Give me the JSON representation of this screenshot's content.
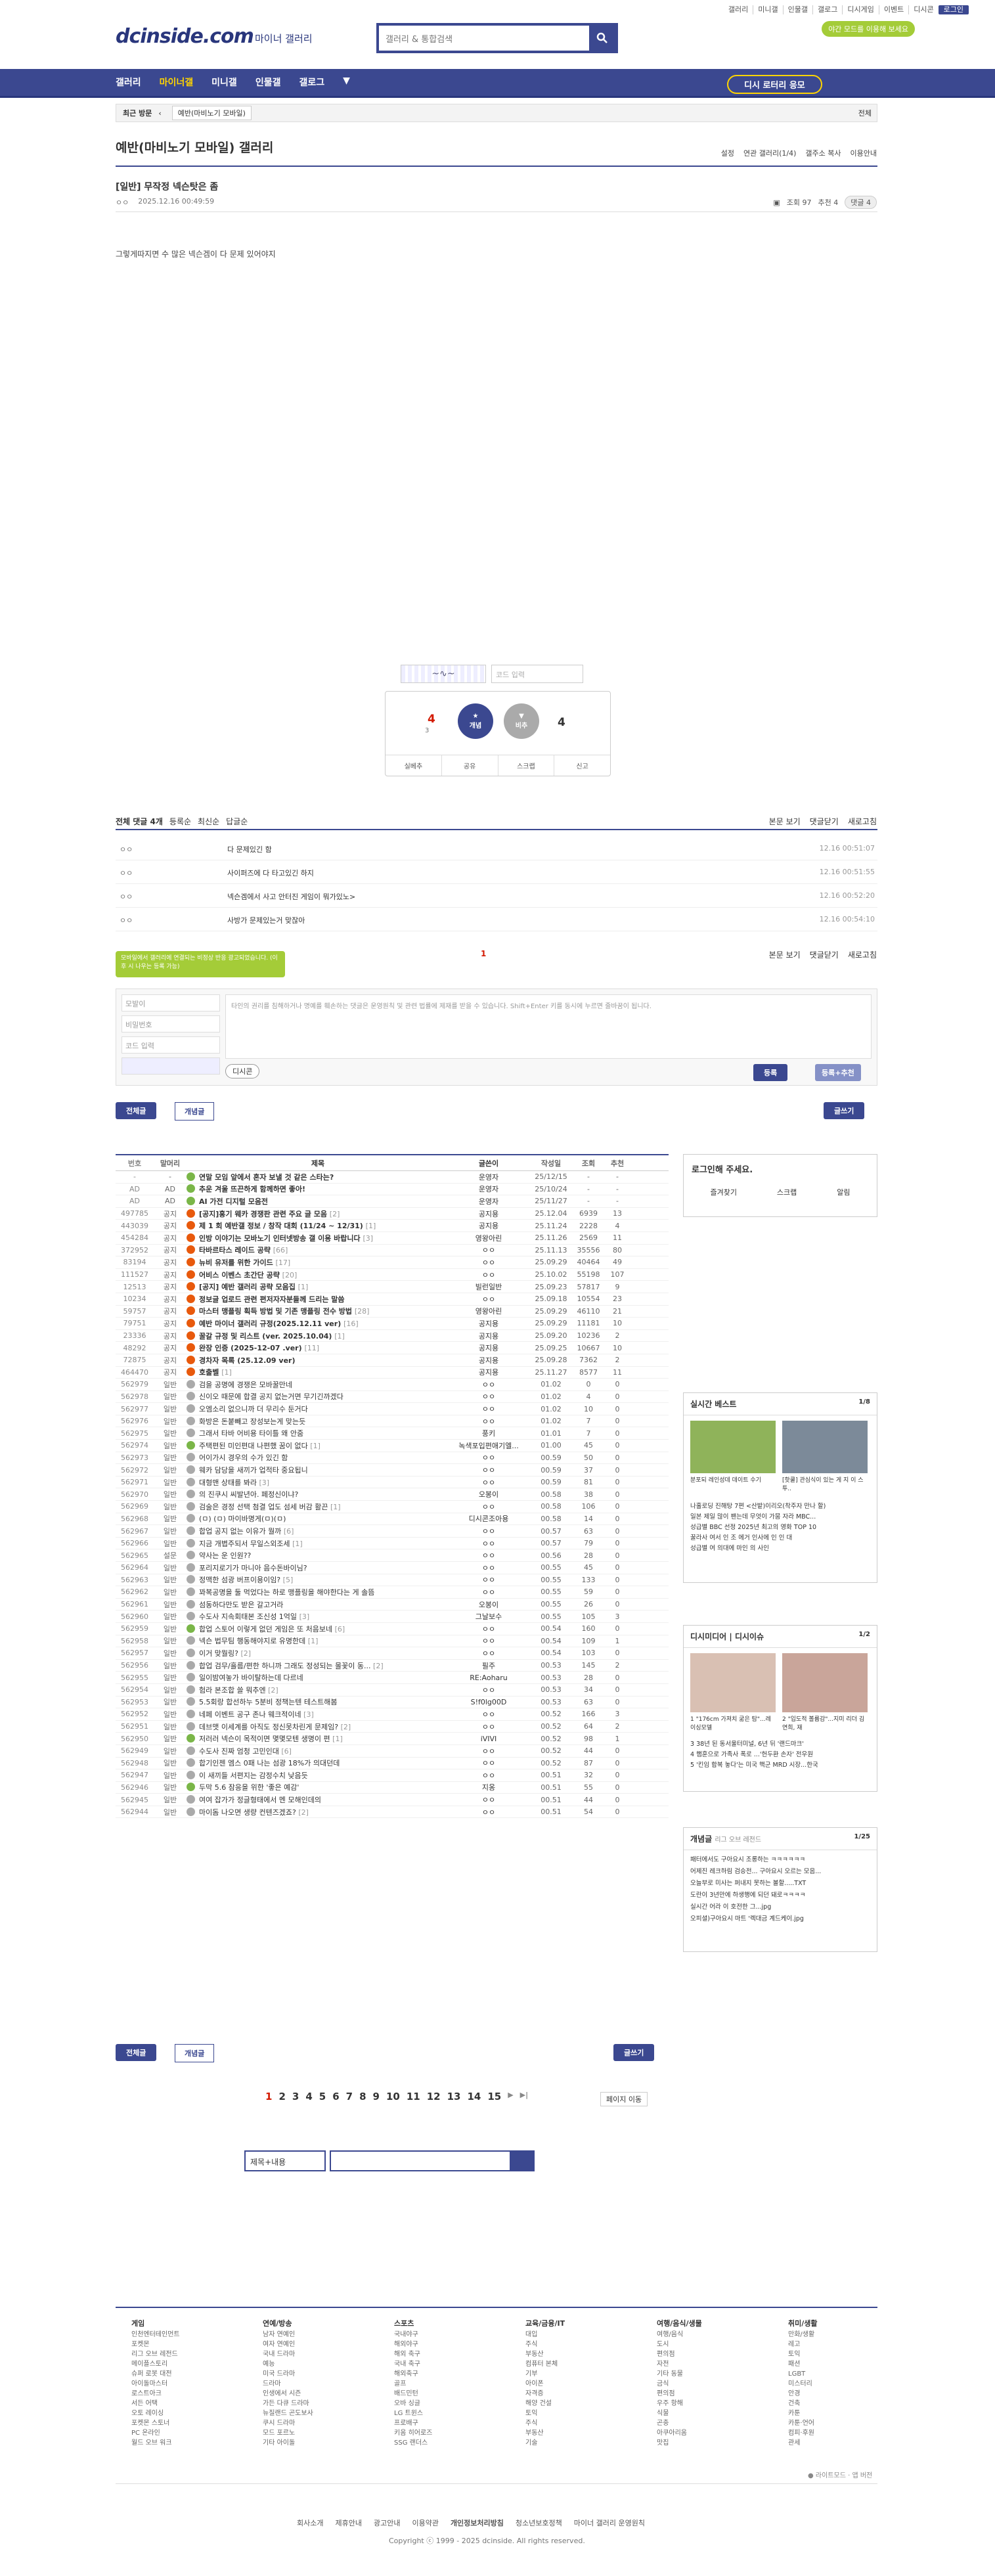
{
  "header": {
    "top_links": [
      "갤러리",
      "미니갤",
      "인물갤",
      "갤로그",
      "디시게임",
      "이벤트",
      "디시콘",
      "로그인"
    ],
    "darkmode": "야간 모드를 이용해 보세요",
    "logo": "dcinside.com",
    "logo_sub": "마이너 갤러리",
    "search_placeholder": "갤러리 & 통합검색"
  },
  "nav": {
    "items": [
      "갤러리",
      "마이너갤",
      "미니갤",
      "인물갤",
      "갤로그"
    ],
    "right_button": "디시 로터리 응모"
  },
  "recent": {
    "label": "최근 방문",
    "chip": "예반(마비노기 모바일)",
    "all": "전체"
  },
  "gallery": {
    "title": "예반(마비노기 모바일) 갤러리",
    "tools": [
      "설정",
      "연관 갤러리(1/4)",
      "갤주소 복사",
      "이용안내"
    ]
  },
  "post": {
    "title": "[일반] 무작정 넥슨탓은 좀",
    "author": "ㅇㅇ",
    "date": "2025.12.16 00:49:59",
    "views": "조회 97",
    "recommend": "추천 4",
    "comments": "댓글 4",
    "body": "그렇게따지면 수 많은 넥슨겜이 다 문제 있어야지"
  },
  "captcha": {
    "placeholder": "코드 입력"
  },
  "reco": {
    "up": "4",
    "up_fix": "3",
    "up_label": "개념",
    "down_label": "비추",
    "down": "4",
    "actions": [
      "실베추",
      "공유",
      "스크랩",
      "신고"
    ]
  },
  "comments": {
    "total": "전체 댓글 4개",
    "sorts": [
      "등록순",
      "최신순",
      "답글순"
    ],
    "right": [
      "본문 보기",
      "댓글닫기",
      "새로고침"
    ],
    "items": [
      {
        "nick": "ㅇㅇ",
        "text": "다 문제있긴 함",
        "date": "12.16 00:51:07"
      },
      {
        "nick": "ㅇㅇ",
        "text": "사이퍼즈에 다 타고있긴 하지",
        "date": "12.16 00:51:55"
      },
      {
        "nick": "ㅇㅇ",
        "text": "넥슨겜에서 사고 안터진 게임이 뭐가있노>",
        "date": "12.16 00:52:20"
      },
      {
        "nick": "ㅇㅇ",
        "text": "사방가 문제있는거 맞잖아",
        "date": "12.16 00:54:10"
      }
    ],
    "count_mid": "1"
  },
  "write": {
    "tip": "모바일에서 갤러리에 연결되는 비정상 반응 광고되었습니다. (이후 시 나우는 등록 가능)",
    "nick": "모발이",
    "pw": "비밀번호",
    "code": "코드 입력",
    "textarea": "타인의 권리를 침해하거나 명예를 훼손하는 댓글은 운영원칙 및 관련 법률에 제재를 받을 수 있습니다. Shift+Enter 키를 동시에 누르면 줄바꿈이 됩니다.",
    "dccon": "디시콘",
    "submit": "등록",
    "submit_rec": "등록+추천"
  },
  "list_buttons": {
    "all": "전체글",
    "concept": "개념글",
    "write": "글쓰기"
  },
  "list": {
    "headers": [
      "번호",
      "말머리",
      "제목",
      "글쓴이",
      "작성일",
      "조회",
      "추천"
    ],
    "rows": [
      {
        "no": "-",
        "tag": "-",
        "title": "연말 모임 앞에서 혼자 보낼 것 같은 스타는?",
        "writer": "운영자",
        "date": "25/12/15",
        "view": "-",
        "rec": "-",
        "notice": true,
        "ic": "gr"
      },
      {
        "no": "AD",
        "tag": "AD",
        "title": "추운 겨울 뜨끈하게 함께하면 좋아!",
        "writer": "운영자",
        "date": "25/10/24",
        "view": "-",
        "rec": "-",
        "notice": true,
        "ic": "gr"
      },
      {
        "no": "AD",
        "tag": "AD",
        "title": "AI 가전 디지털 모음전",
        "writer": "운영자",
        "date": "25/11/27",
        "view": "-",
        "rec": "-",
        "notice": true,
        "ic": "gr"
      },
      {
        "no": "497785",
        "tag": "공지",
        "title": "[공지]홍기 웨카 경쟁판 관련 주요 글 모음",
        "cc": "[2]",
        "writer": "공지용",
        "date": "25.12.04",
        "view": "6939",
        "rec": "13",
        "notice": true,
        "ic": "o"
      },
      {
        "no": "443039",
        "tag": "공지",
        "title": "제 1 회 예반갤 정보 / 창작 대회 (11/24 ~ 12/31)",
        "cc": "[1]",
        "writer": "공지용",
        "date": "25.11.24",
        "view": "2228",
        "rec": "4",
        "notice": true,
        "ic": "o"
      },
      {
        "no": "454284",
        "tag": "공지",
        "title": "인방 이야기는 모바노기 인터넷방송 갤 이용 바랍니다",
        "cc": "[3]",
        "writer": "영왕아린",
        "date": "25.11.26",
        "view": "2569",
        "rec": "11",
        "notice": true,
        "ic": "o"
      },
      {
        "no": "372952",
        "tag": "공지",
        "title": "타바르타스 레이드 공략",
        "cc": "[66]",
        "writer": "ㅇㅇ",
        "date": "25.11.13",
        "view": "35556",
        "rec": "80",
        "notice": true,
        "ic": "o"
      },
      {
        "no": "83194",
        "tag": "공지",
        "title": "뉴비 유저를 위한 가이드",
        "cc": "[17]",
        "writer": "ㅇㅇ",
        "date": "25.09.29",
        "view": "40464",
        "rec": "49",
        "notice": true,
        "ic": "o"
      },
      {
        "no": "111527",
        "tag": "공지",
        "title": "어비스 이벤스 초간단 공략",
        "cc": "[20]",
        "writer": "ㅇㅇ",
        "date": "25.10.02",
        "view": "55198",
        "rec": "107",
        "notice": true,
        "ic": "o"
      },
      {
        "no": "12513",
        "tag": "공지",
        "title": "[공지] 예반 갤러리 공략 모음집",
        "cc": "[1]",
        "writer": "빌런일반",
        "date": "25.09.23",
        "view": "57817",
        "rec": "9",
        "notice": true,
        "ic": "o"
      },
      {
        "no": "10234",
        "tag": "공지",
        "title": "정보글 업로드 관련 편저자자분들께 드리는 말씀",
        "writer": "ㅇㅇ",
        "date": "25.09.18",
        "view": "10554",
        "rec": "23",
        "notice": true,
        "ic": "o"
      },
      {
        "no": "59757",
        "tag": "공지",
        "title": "마스터 맹플링 획득 방법 및 기존 맹플링 전수 방법",
        "cc": "[28]",
        "writer": "영왕아린",
        "date": "25.09.29",
        "view": "46110",
        "rec": "21",
        "notice": true,
        "ic": "o"
      },
      {
        "no": "79751",
        "tag": "공지",
        "title": "예반 마이너 갤러리 규정(2025.12.11 ver)",
        "cc": "[16]",
        "writer": "공지용",
        "date": "25.09.29",
        "view": "11181",
        "rec": "10",
        "notice": true,
        "ic": "o"
      },
      {
        "no": "23336",
        "tag": "공지",
        "title": "꿀갈 규정 및 리스트 (ver. 2025.10.04)",
        "cc": "[1]",
        "writer": "공지용",
        "date": "25.09.20",
        "view": "10236",
        "rec": "2",
        "notice": true,
        "ic": "o"
      },
      {
        "no": "48292",
        "tag": "공지",
        "title": "완장 인증 (2025-12-07 .ver)",
        "cc": "[11]",
        "writer": "공지용",
        "date": "25.09.25",
        "view": "10667",
        "rec": "10",
        "notice": true,
        "ic": "o"
      },
      {
        "no": "72875",
        "tag": "공지",
        "title": "경차자 목록 (25.12.09 ver)",
        "writer": "공지용",
        "date": "25.09.28",
        "view": "7362",
        "rec": "2",
        "notice": true,
        "ic": "o"
      },
      {
        "no": "464470",
        "tag": "공지",
        "title": "호출벨",
        "cc": "[1]",
        "writer": "공지용",
        "date": "25.11.27",
        "view": "8577",
        "rec": "11",
        "notice": true,
        "ic": "o"
      },
      {
        "no": "562979",
        "tag": "일반",
        "title": "검을 공명에 경쟁은 모바꿀만네",
        "writer": "ㅇㅇ",
        "date": "01.02",
        "view": "0",
        "rec": "0",
        "ic": "g"
      },
      {
        "no": "562978",
        "tag": "일반",
        "title": "신이오 때문에 합결 공지 없는거면 무기긴까겠다",
        "writer": "ㅇㅇ",
        "date": "01.02",
        "view": "4",
        "rec": "0",
        "ic": "g"
      },
      {
        "no": "562977",
        "tag": "일반",
        "title": "오엠소리 없으니까 더 무리수 둔거다",
        "writer": "ㅇㅇ",
        "date": "01.02",
        "view": "10",
        "rec": "0",
        "ic": "g"
      },
      {
        "no": "562976",
        "tag": "일반",
        "title": "화방은 돈붙빼고 장성보는게 맞는듯",
        "writer": "ㅇㅇ",
        "date": "01.02",
        "view": "7",
        "rec": "0",
        "ic": "g"
      },
      {
        "no": "562975",
        "tag": "일반",
        "title": "그래서 타바 어비용 타이틀 왜 안줌",
        "writer": "풍키",
        "date": "01.01",
        "view": "7",
        "rec": "0",
        "ic": "g"
      },
      {
        "no": "562974",
        "tag": "일반",
        "title": "주택편된 미인편대 나편했 꿈이 없다",
        "cc": "[1]",
        "writer": "녹색포입편애기엘...",
        "date": "01.00",
        "view": "45",
        "rec": "0",
        "ic": "gr"
      },
      {
        "no": "562973",
        "tag": "일반",
        "title": "어이가시 경우의 수가 있긴 함",
        "writer": "ㅇㅇ",
        "date": "00.59",
        "view": "50",
        "rec": "0",
        "ic": "g"
      },
      {
        "no": "562972",
        "tag": "일반",
        "title": "웨카 담당을 새끼가 업적타 중요됩니",
        "writer": "ㅇㅇ",
        "date": "00.59",
        "view": "37",
        "rec": "0",
        "ic": "g"
      },
      {
        "no": "562971",
        "tag": "일반",
        "title": "대형맨 상태를 봐라",
        "cc": "[3]",
        "writer": "ㅇㅇ",
        "date": "00.59",
        "view": "81",
        "rec": "0",
        "ic": "g"
      },
      {
        "no": "562970",
        "tag": "일반",
        "title": "의 진쿠시 씨발년아. 페정신이냐?",
        "writer": "오봉이",
        "date": "00.58",
        "view": "38",
        "rec": "0",
        "ic": "g"
      },
      {
        "no": "562969",
        "tag": "일반",
        "title": "검술은 경정 선택 첨결 업도 섬세 버감 활끈",
        "cc": "[1]",
        "writer": "ㅇㅇ",
        "date": "00.58",
        "view": "106",
        "rec": "0",
        "ic": "g"
      },
      {
        "no": "562968",
        "tag": "일반",
        "title": "(ㅁ) (ㅁ) 마이바명게(ㅁ)(ㅁ)",
        "writer": "디시콘조아용",
        "date": "00.58",
        "view": "14",
        "rec": "0",
        "ic": "g"
      },
      {
        "no": "562967",
        "tag": "일반",
        "title": "합업 공지 없는 이유가 뭘까",
        "cc": "[6]",
        "writer": "ㅇㅇ",
        "date": "00.57",
        "view": "63",
        "rec": "0",
        "ic": "g"
      },
      {
        "no": "562966",
        "tag": "일반",
        "title": "지금 개볍주되서 무일스외조세",
        "cc": "[1]",
        "writer": "ㅇㅇ",
        "date": "00.57",
        "view": "79",
        "rec": "0",
        "ic": "g"
      },
      {
        "no": "562965",
        "tag": "설문",
        "title": "약사는 운 인원??",
        "writer": "ㅇㅇ",
        "date": "00.56",
        "view": "28",
        "rec": "0",
        "ic": "g"
      },
      {
        "no": "562964",
        "tag": "일반",
        "title": "포리지로기가 마니아 음수돈바이님?",
        "writer": "ㅇㅇ",
        "date": "00.55",
        "view": "45",
        "rec": "0",
        "ic": "g"
      },
      {
        "no": "562963",
        "tag": "일반",
        "title": "정맥한 섬광 버프이용이임?",
        "cc": "[5]",
        "writer": "ㅇㅇ",
        "date": "00.55",
        "view": "133",
        "rec": "0",
        "ic": "g"
      },
      {
        "no": "562962",
        "tag": "일반",
        "title": "꽈복공명을 둘 먹었다는 하로 맹플링을 해야한다는 게 솔뜸",
        "writer": "ㅇㅇ",
        "date": "00.55",
        "view": "59",
        "rec": "0",
        "ic": "g"
      },
      {
        "no": "562961",
        "tag": "일반",
        "title": "섬동하다만도 받은 갈고거라",
        "writer": "오봉이",
        "date": "00.55",
        "view": "26",
        "rec": "0",
        "ic": "g"
      },
      {
        "no": "562960",
        "tag": "일반",
        "title": "수도사 지속회태본 조신성 1억일",
        "cc": "[3]",
        "writer": "그날보수",
        "date": "00.55",
        "view": "105",
        "rec": "3",
        "ic": "g"
      },
      {
        "no": "562959",
        "tag": "일반",
        "title": "합업 스토어 이렇게 없던 게임은 또 처음보네",
        "cc": "[6]",
        "writer": "ㅇㅇ",
        "date": "00.54",
        "view": "160",
        "rec": "0",
        "ic": "gr"
      },
      {
        "no": "562958",
        "tag": "일반",
        "title": "넥슨 법무팀 행동해야지로 유명한데",
        "cc": "[1]",
        "writer": "ㅇㅇ",
        "date": "00.54",
        "view": "109",
        "rec": "1",
        "ic": "g"
      },
      {
        "no": "562957",
        "tag": "일반",
        "title": "이거 맞뭘링?",
        "cc": "[2]",
        "writer": "ㅇㅇ",
        "date": "00.54",
        "view": "103",
        "rec": "0",
        "ic": "g"
      },
      {
        "no": "562956",
        "tag": "일반",
        "title": "합업 검무/흘름/편한 하니까 그래도 정성되는 몰꽃이 동...",
        "cc": "[2]",
        "writer": "필주",
        "date": "00.53",
        "view": "145",
        "rec": "2",
        "ic": "g"
      },
      {
        "no": "562955",
        "tag": "일반",
        "title": "일이밤여놓가 바이탈하는데 다르네",
        "writer": "RE:Aoharu",
        "date": "00.53",
        "view": "28",
        "rec": "0",
        "ic": "g"
      },
      {
        "no": "562954",
        "tag": "일반",
        "title": "험라 본조합 쓸 뭐추엔",
        "cc": "[2]",
        "writer": "ㅇㅇ",
        "date": "00.53",
        "view": "34",
        "rec": "0",
        "ic": "g"
      },
      {
        "no": "562953",
        "tag": "일반",
        "title": "5.5회랑 합선하누 5분비 정책는텐 테스트해봄",
        "writer": "S!f0lg00D",
        "date": "00.53",
        "view": "63",
        "rec": "0",
        "ic": "g"
      },
      {
        "no": "562952",
        "tag": "일반",
        "title": "네페 이벤트 공구 존나 웨크적이네",
        "cc": "[3]",
        "writer": "ㅇㅇ",
        "date": "00.52",
        "view": "166",
        "rec": "3",
        "ic": "g"
      },
      {
        "no": "562951",
        "tag": "일반",
        "title": "데브맷 이세계를 아직도 정신못차린게 문제임?",
        "cc": "[2]",
        "writer": "ㅇㅇ",
        "date": "00.52",
        "view": "64",
        "rec": "2",
        "ic": "g"
      },
      {
        "no": "562950",
        "tag": "일반",
        "title": "저러러 넥슨이 목적이면 몇몇모텐 생명이 편",
        "cc": "[1]",
        "writer": "iVIVI",
        "date": "00.52",
        "view": "98",
        "rec": "1",
        "ic": "gr"
      },
      {
        "no": "562949",
        "tag": "일반",
        "title": "수도사 진짜 엄청 고민인대",
        "cc": "[6]",
        "writer": "ㅇㅇ",
        "date": "00.52",
        "view": "44",
        "rec": "0",
        "ic": "g"
      },
      {
        "no": "562948",
        "tag": "일반",
        "title": "합기인젠 엠스 0패 나는 섬광 18%가 의대던데",
        "writer": "ㅇㅇ",
        "date": "00.52",
        "view": "87",
        "rec": "0",
        "ic": "g"
      },
      {
        "no": "562947",
        "tag": "일반",
        "title": "이 새끼들 서편지는 감정수치 낮음듯",
        "writer": "ㅇㅇ",
        "date": "00.51",
        "view": "32",
        "rec": "0",
        "ic": "g"
      },
      {
        "no": "562946",
        "tag": "일반",
        "title": "두막 5.6 잠응을 위한 '좋은 예감'",
        "writer": "지옹",
        "date": "00.51",
        "view": "55",
        "rec": "0",
        "ic": "gr"
      },
      {
        "no": "562945",
        "tag": "일반",
        "title": "여여 잡가가 정글형태에서 멘 모해인데의",
        "writer": "ㅇㅇ",
        "date": "00.51",
        "view": "44",
        "rec": "0",
        "ic": "g"
      },
      {
        "no": "562944",
        "tag": "일반",
        "title": "마이돔 나오면 생량 컨텐즈겠죠?",
        "cc": "[2]",
        "writer": "ㅇㅇ",
        "date": "00.51",
        "view": "54",
        "rec": "0",
        "ic": "g"
      }
    ]
  },
  "side": {
    "login_title": "로그인해 주세요.",
    "login_btns": [
      "즐겨찾기",
      "스크랩",
      "알림"
    ],
    "live_title": "실시간 베스트",
    "live_page": "1/8",
    "live_caps": [
      "분포되 레인성데 데이트 수기",
      "[핫쿨] 관심식이 있는 게 지 이 스투.."
    ],
    "live_list": [
      "나홀로딩 진해탕 7편 <산밭)이리오(착주자 만나 할)",
      "일본 제일 많이 팬는데 무엇이 가뭄 자라 MBC...",
      "성급별 BBC 선정 2025년 최고의 영화 TOP 10",
      "꿀라사 여서 인 조 에거 인사에 인 인 대",
      "성급별 여 의대에 마인 의 사인"
    ],
    "dc_title": "디시미디어 | 디시이슈",
    "dc_page": "1/2",
    "dc_caps": [
      "1 \"176cm 가져치 굶은 탐\"...레이싱모델",
      "2 \"입도적 볼륨감\"...지미 리더 김연희, 재"
    ],
    "dc_list": [
      "3 38년 된 동서울터미널, 6년 뒤 '랜드마크'",
      "4 햄훈으로 가족사 폭로 ...'헌두환 손자' 전우원",
      "5 '킨임 합복 놓다'는 미국 핵군 MRD 시장...한국"
    ],
    "concept_title": "개념글",
    "concept_sub": "리그 오브 레전드",
    "concept_page": "1/25",
    "concept_list": [
      "패터에서도 구아요시 조롱하는 ㅋㅋㅋㅋㅋㅋ",
      "어제진 레크하림 검승전... 구아요시 오르는 모음...",
      "오늘부로 미사는 퍼내지 못하는 볼할.....TXT",
      "도란이 3년만에 하생행에 되던 돼로ㅋㅋㅋㅋ",
      "실시간 어라 이 호전한 그...jpg",
      "오피셜)구아요시 마트 '렉대금 계드케이.jpg"
    ]
  },
  "pager": {
    "pages": [
      "1",
      "2",
      "3",
      "4",
      "5",
      "6",
      "7",
      "8",
      "9",
      "10",
      "11",
      "12",
      "13",
      "14",
      "15"
    ],
    "jump": "페이지 이동"
  },
  "bsearch": {
    "select": "제목+내용"
  },
  "footer": {
    "cols": [
      {
        "title": "게임",
        "items": [
          "인천엔터테인먼트",
          "포켓몬",
          "리그 오브 레전드",
          "메이플스토리",
          "슈퍼 로봇 대전",
          "아이돌마스터",
          "로스트아크",
          "서든 어택",
          "오토 레이싱",
          "포켓몬 스토너",
          "PC 온라인",
          "월드 오브 워크"
        ]
      },
      {
        "title": "연예/방송",
        "items": [
          "남자 연예인",
          "여자 연예인",
          "국내 드라마",
          "예능",
          "미국 드라마",
          "드라마",
          "인생에서 시즌",
          "가든 다큐 드라마",
          "뉴질랜드 곤도보사",
          "쿠시 드라마",
          "모드 포르노",
          "기타 아이돌"
        ]
      },
      {
        "title": "스포츠",
        "items": [
          "국내야구",
          "해외야구",
          "해외 축구",
          "국내 축구",
          "해외축구",
          "골프",
          "배드민턴",
          "오바 싱글",
          "LG 트윈스",
          "프로배구",
          "키움 히어로즈",
          "SSG 랜더스"
        ]
      },
      {
        "title": "교육/금융/IT",
        "items": [
          "대입",
          "주식",
          "부동산",
          "컴퓨터 본체",
          "기부",
          "아이폰",
          "자격증",
          "해양 건설",
          "토익",
          "주식",
          "부동산",
          "기술"
        ]
      },
      {
        "title": "여행/음식/생물",
        "items": [
          "여행/음식",
          "도시",
          "편의점",
          "자전",
          "기타 동물",
          "금식",
          "편의점",
          "우주 항해",
          "식물",
          "곤충",
          "아쿠아리움",
          "맛집"
        ]
      },
      {
        "title": "취미/생활",
        "items": [
          "만화/생활",
          "레고",
          "토익",
          "패션",
          "LGBT",
          "미스터리",
          "안경",
          "건축",
          "카툰",
          "카툰·언어",
          "컴피·후원",
          "관세"
        ]
      }
    ],
    "bottom": [
      "회사소개",
      "제휴안내",
      "광고안내",
      "이용약관",
      "개인정보처리방침",
      "청소년보호정책",
      "마이너 갤러리 운영원칙"
    ],
    "copyright": "Copyright ⓒ 1999 - 2025 dcinside. All rights reserved."
  }
}
